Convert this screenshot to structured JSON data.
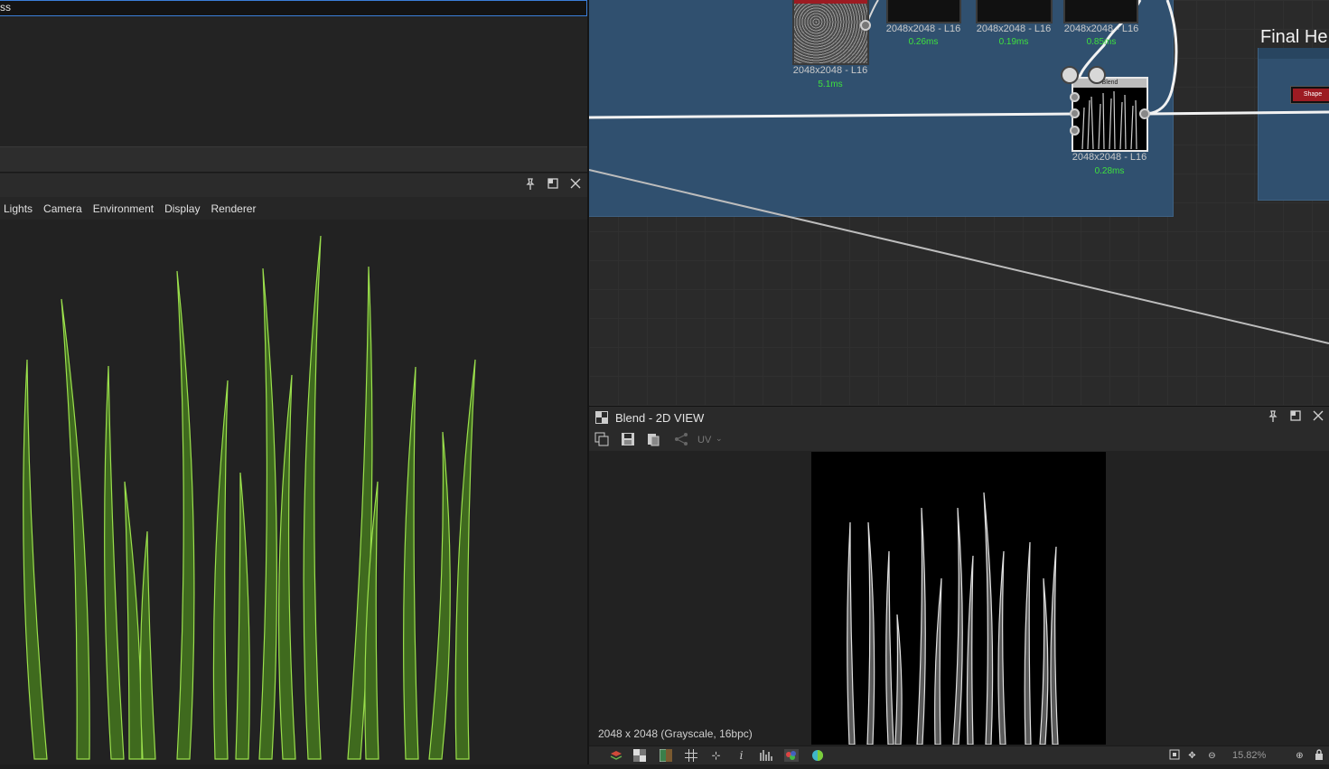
{
  "left_panel": {
    "search_value": "ss"
  },
  "view3d": {
    "menu": [
      "Lights",
      "Camera",
      "Environment",
      "Display",
      "Renderer"
    ],
    "icons": [
      "pin-icon",
      "maximize-icon",
      "close-icon"
    ]
  },
  "graph": {
    "frame_title": "Final He",
    "nodes": [
      {
        "name": "noise-node",
        "label": "2048x2048 - L16",
        "time": "5.1ms"
      },
      {
        "name": "node-a",
        "label": "2048x2048 - L16",
        "time": "0.26ms"
      },
      {
        "name": "node-b",
        "label": "2048x2048 - L16",
        "time": "0.19ms"
      },
      {
        "name": "node-c",
        "label": "2048x2048 - L16",
        "time": "0.85ms"
      },
      {
        "name": "blend-node",
        "label": "2048x2048 - L16",
        "time": "0.28ms",
        "header": "Blend"
      }
    ],
    "shape_node_label": "Shape"
  },
  "view2d": {
    "title": "Blend - 2D VIEW",
    "uv_label": "UV",
    "image_info": "2048 x 2048 (Grayscale, 16bpc)",
    "zoom": "15.82%"
  },
  "colors": {
    "frame": "#30506f",
    "timing": "#3ee03e",
    "grass": "#7cc43a",
    "accent_red": "#9c1b22"
  }
}
